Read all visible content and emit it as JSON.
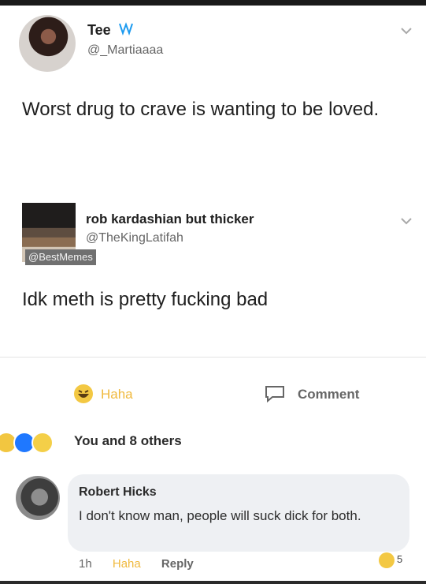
{
  "tweet1": {
    "author_name": "Tee",
    "author_handle": "@_Martiaaaa",
    "text": "Worst drug to crave is wanting to be loved."
  },
  "tweet2": {
    "author_name": "rob kardashian but thicker",
    "author_handle": "@TheKingLatifah",
    "watermark": "@BestMemes",
    "text": "Idk meth is pretty fucking bad"
  },
  "actions": {
    "haha_label": "Haha",
    "comment_label": "Comment"
  },
  "reactions": {
    "summary": "You and 8 others"
  },
  "comment": {
    "author": "Robert Hicks",
    "text": "I don't know man, people will suck dick for both.",
    "time": "1h",
    "haha": "Haha",
    "reply": "Reply",
    "reaction_count": "5"
  },
  "colors": {
    "haha_yellow": "#f0b93d",
    "like_blue": "#1f78ff",
    "bubble_bg": "#eef0f3"
  },
  "icons": [
    "verified-badge-icon",
    "chevron-down-icon",
    "haha-emoji-icon",
    "comment-icon",
    "like-reaction-icon"
  ]
}
